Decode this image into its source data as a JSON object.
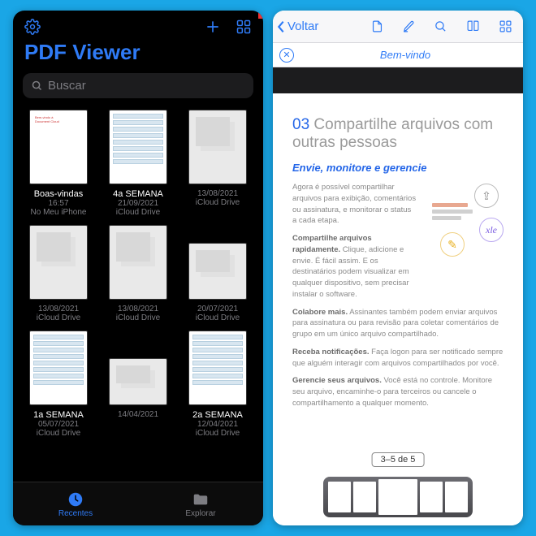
{
  "left": {
    "app_title": "PDF Viewer",
    "search_placeholder": "Buscar",
    "files": [
      {
        "name": "Boas-vindas",
        "meta": "16:57",
        "loc": "No Meu iPhone"
      },
      {
        "name": "4a SEMANA",
        "meta": "21/09/2021",
        "loc": "iCloud Drive"
      },
      {
        "name": "",
        "meta": "13/08/2021",
        "loc": "iCloud Drive"
      },
      {
        "name": "",
        "meta": "13/08/2021",
        "loc": "iCloud Drive"
      },
      {
        "name": "",
        "meta": "13/08/2021",
        "loc": "iCloud Drive"
      },
      {
        "name": "",
        "meta": "20/07/2021",
        "loc": "iCloud Drive"
      },
      {
        "name": "1a SEMANA",
        "meta": "05/07/2021",
        "loc": "iCloud Drive"
      },
      {
        "name": "",
        "meta": "14/04/2021",
        "loc": ""
      },
      {
        "name": "2a SEMANA",
        "meta": "12/04/2021",
        "loc": "iCloud Drive"
      }
    ],
    "tabs": {
      "recent": "Recentes",
      "explore": "Explorar"
    }
  },
  "right": {
    "back": "Voltar",
    "doc_title": "Bem-vindo",
    "heading_num": "03",
    "heading_rest": "Compartilhe arquivos com outras pessoas",
    "sub": "Envie, monitore e gerencie",
    "intro": "Agora é possível compartilhar arquivos para exibição, comentários ou assinatura, e monitorar o status a cada etapa.",
    "p1b": "Compartilhe arquivos rapidamente.",
    "p1": " Clique, adicione e envie. É fácil assim. E os destinatários podem visualizar em qualquer dispositivo, sem precisar instalar o software.",
    "p2b": "Colabore mais.",
    "p2": " Assinantes também podem enviar arquivos para assinatura ou para revisão para coletar comentários de grupo em um único arquivo compartilhado.",
    "p3b": "Receba notificações.",
    "p3": " Faça logon para ser notificado sempre que alguém interagir com arquivos compartilhados por você.",
    "p4b": "Gerencie seus arquivos.",
    "p4": " Você está no controle. Monitore seu arquivo, encaminhe-o para terceiros ou cancele o compartilhamento a qualquer momento.",
    "page_indicator": "3–5 de 5"
  }
}
